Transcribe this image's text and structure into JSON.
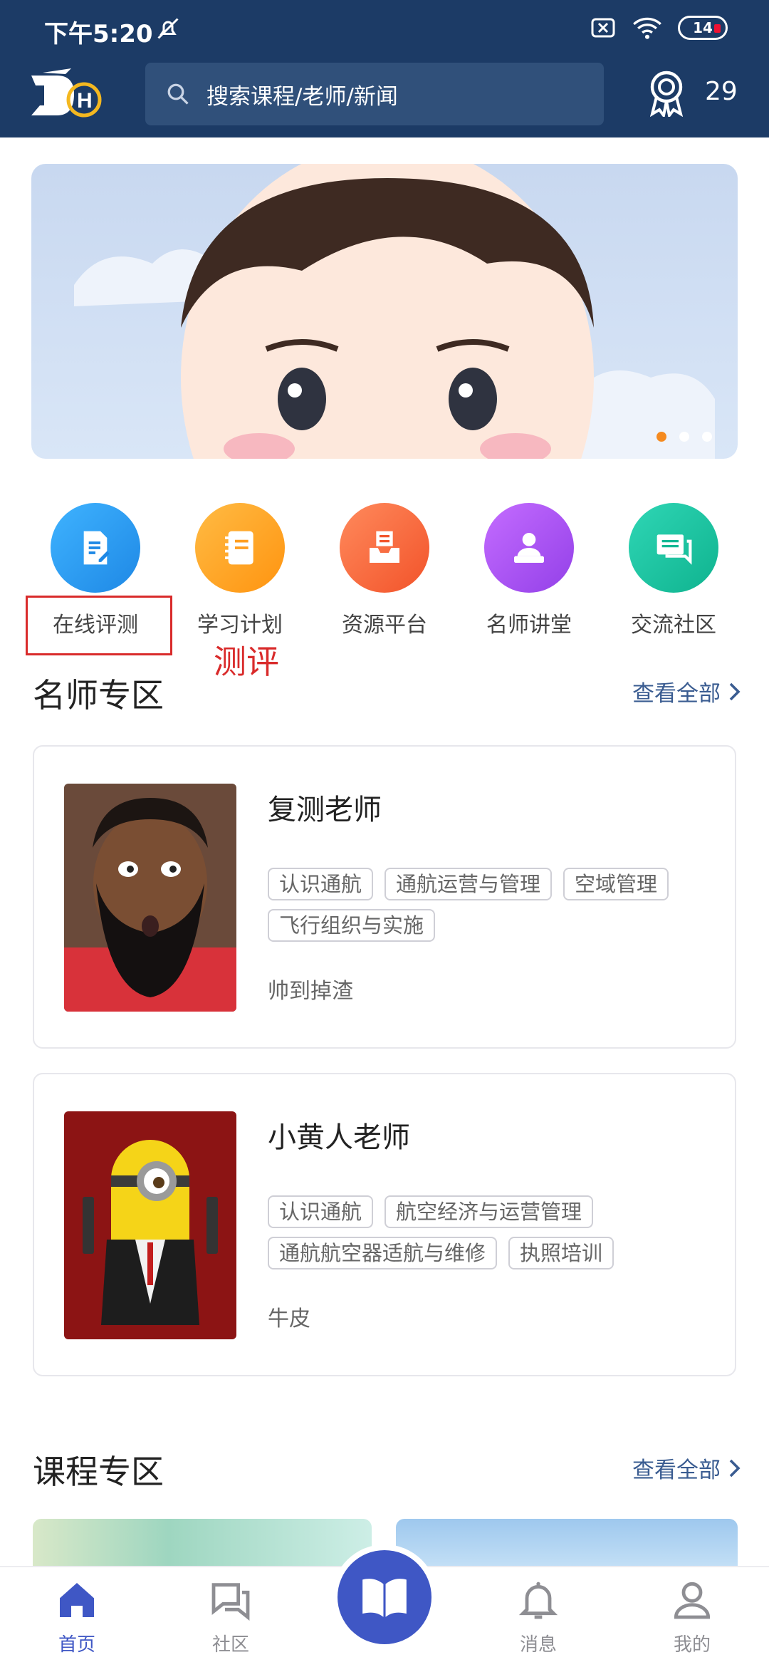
{
  "status_bar": {
    "time": "下午5:20",
    "battery": "14"
  },
  "header": {
    "search_placeholder": "搜索课程/老师/新闻",
    "points": "29"
  },
  "quick_nav": [
    {
      "label": "在线评测",
      "color": "#1e9af0"
    },
    {
      "label": "学习计划",
      "color": "#ffa01f"
    },
    {
      "label": "资源平台",
      "color": "#ff6a3d"
    },
    {
      "label": "名师讲堂",
      "color": "#a44ff0"
    },
    {
      "label": "交流社区",
      "color": "#14c0a0"
    }
  ],
  "annotation": {
    "text": "测评"
  },
  "teachers_section": {
    "title": "名师专区",
    "more": "查看全部",
    "teachers": [
      {
        "name": "复测老师",
        "tags": [
          "认识通航",
          "通航运营与管理",
          "空域管理",
          "飞行组织与实施"
        ],
        "desc": "帅到掉渣"
      },
      {
        "name": "小黄人老师",
        "tags": [
          "认识通航",
          "航空经济与运营管理",
          "通航航空器适航与维修",
          "执照培训"
        ],
        "desc": "牛皮"
      }
    ]
  },
  "courses_section": {
    "title": "课程专区",
    "more": "查看全部"
  },
  "bottom_nav": {
    "home": "首页",
    "community": "社区",
    "messages": "消息",
    "mine": "我的"
  }
}
